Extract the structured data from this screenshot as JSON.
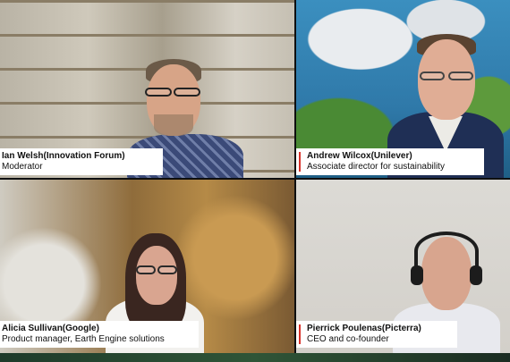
{
  "participants": [
    {
      "name": "Ian Welsh(Innovation Forum)",
      "role": "Moderator"
    },
    {
      "name": "Andrew Wilcox(Unilever)",
      "role": "Associate director for sustainability"
    },
    {
      "name": "Alicia Sullivan(Google)",
      "role": "Product manager, Earth Engine solutions"
    },
    {
      "name": "Pierrick Poulenas(Picterra)",
      "role": "CEO and co-founder"
    }
  ],
  "accent_color": "#d9322b"
}
